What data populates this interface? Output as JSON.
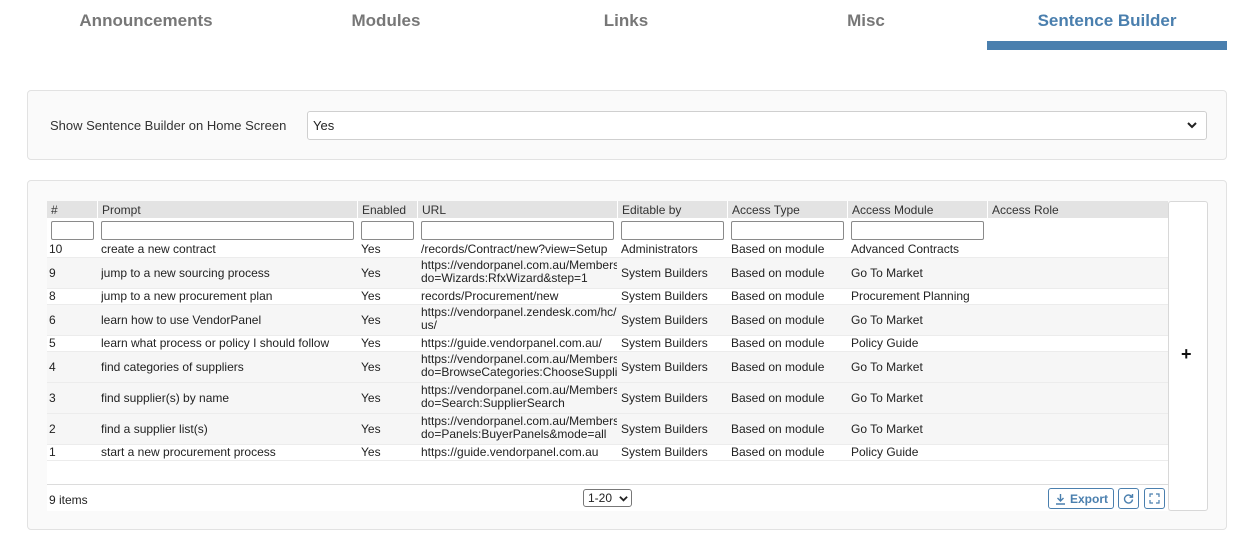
{
  "tabs": [
    {
      "label": "Announcements",
      "active": false
    },
    {
      "label": "Modules",
      "active": false
    },
    {
      "label": "Links",
      "active": false
    },
    {
      "label": "Misc",
      "active": false
    },
    {
      "label": "Sentence Builder",
      "active": true
    }
  ],
  "settings": {
    "label": "Show Sentence Builder on Home Screen",
    "value": "Yes"
  },
  "grid": {
    "columns": [
      "#",
      "Prompt",
      "Enabled",
      "URL",
      "Editable by",
      "Access Type",
      "Access Module",
      "Access Role"
    ],
    "rows": [
      {
        "num": "10",
        "prompt": "create a new contract",
        "enabled": "Yes",
        "url": "/records/Contract/new?view=Setup",
        "editable": "Administrators",
        "access_type": "Based on module",
        "access_module": "Advanced Contracts",
        "access_role": ""
      },
      {
        "num": "9",
        "prompt": "jump to a new sourcing process",
        "enabled": "Yes",
        "url": "https://vendorpanel.com.au/Members\ndo=Wizards:RfxWizard&step=1",
        "editable": "System Builders",
        "access_type": "Based on module",
        "access_module": "Go To Market",
        "access_role": ""
      },
      {
        "num": "8",
        "prompt": "jump to a new procurement plan",
        "enabled": "Yes",
        "url": "records/Procurement/new",
        "editable": "System Builders",
        "access_type": "Based on module",
        "access_module": "Procurement Planning",
        "access_role": ""
      },
      {
        "num": "6",
        "prompt": "learn how to use VendorPanel",
        "enabled": "Yes",
        "url": "https://vendorpanel.zendesk.com/hc/\nus/",
        "editable": "System Builders",
        "access_type": "Based on module",
        "access_module": "Go To Market",
        "access_role": ""
      },
      {
        "num": "5",
        "prompt": "learn what process or policy I should follow",
        "enabled": "Yes",
        "url": "https://guide.vendorpanel.com.au/",
        "editable": "System Builders",
        "access_type": "Based on module",
        "access_module": "Policy Guide",
        "access_role": ""
      },
      {
        "num": "4",
        "prompt": "find categories of suppliers",
        "enabled": "Yes",
        "url": "https://vendorpanel.com.au/Members\ndo=BrowseCategories:ChooseSuppli",
        "editable": "System Builders",
        "access_type": "Based on module",
        "access_module": "Go To Market",
        "access_role": ""
      },
      {
        "num": "3",
        "prompt": "find supplier(s) by name",
        "enabled": "Yes",
        "url": "https://vendorpanel.com.au/Members\ndo=Search:SupplierSearch",
        "editable": "System Builders",
        "access_type": "Based on module",
        "access_module": "Go To Market",
        "access_role": ""
      },
      {
        "num": "2",
        "prompt": "find a supplier list(s)",
        "enabled": "Yes",
        "url": "https://vendorpanel.com.au/Members\ndo=Panels:BuyerPanels&mode=all",
        "editable": "System Builders",
        "access_type": "Based on module",
        "access_module": "Go To Market",
        "access_role": ""
      },
      {
        "num": "1",
        "prompt": "start a new procurement process",
        "enabled": "Yes",
        "url": "https://guide.vendorpanel.com.au",
        "editable": "System Builders",
        "access_type": "Based on module",
        "access_module": "Policy Guide",
        "access_role": ""
      }
    ],
    "footer": {
      "count": "9 items",
      "page_size": "1-20",
      "export_label": "Export"
    }
  },
  "add_button_label": "+",
  "colors": {
    "accent": "#4a7fae",
    "header_bg": "#e3e3e3"
  },
  "icons": [
    "chevron-down-icon",
    "download-icon",
    "refresh-icon",
    "fullscreen-icon",
    "plus-icon"
  ]
}
